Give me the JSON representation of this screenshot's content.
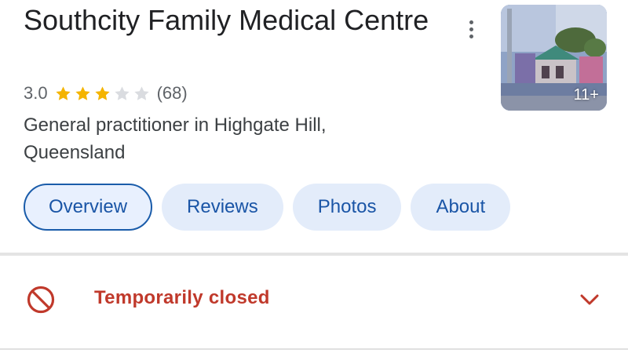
{
  "place": {
    "title": "Southcity Family Medical Centre",
    "rating": "3.0",
    "stars_filled": 3,
    "stars_total": 5,
    "review_count": "(68)",
    "category": "General practitioner in Highgate Hill, Queensland"
  },
  "photo": {
    "count_label": "11+"
  },
  "tabs": [
    {
      "label": "Overview",
      "active": true
    },
    {
      "label": "Reviews",
      "active": false
    },
    {
      "label": "Photos",
      "active": false
    },
    {
      "label": "About",
      "active": false
    }
  ],
  "status": {
    "label": "Temporarily closed",
    "color": "#c0392b"
  },
  "colors": {
    "star_filled": "#f4b400",
    "star_empty": "#dadce0",
    "accent": "#1a55a6"
  },
  "icons": {
    "more": "more-vert-icon",
    "status": "prohibited-icon",
    "expand": "chevron-down-icon"
  }
}
